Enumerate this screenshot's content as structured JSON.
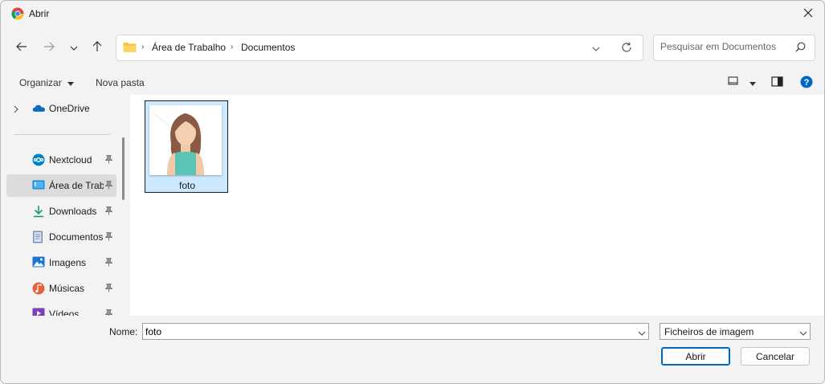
{
  "window": {
    "title": "Abrir",
    "app_icon": "chrome-icon",
    "close_icon": "close-icon"
  },
  "nav": {
    "back_icon": "arrow-left-icon",
    "forward_icon": "arrow-right-icon",
    "recent_icon": "chevron-down-icon",
    "up_icon": "arrow-up-icon",
    "breadcrumbs": [
      "Área de Trabalho",
      "Documentos"
    ],
    "search_placeholder": "Pesquisar em Documentos"
  },
  "commands": {
    "organize": "Organizar",
    "new_folder": "Nova pasta",
    "view_icon": "view-layout-icon",
    "preview_pane_icon": "preview-pane-icon",
    "help_icon": "help-icon"
  },
  "sidebar": {
    "items": [
      {
        "label": "OneDrive",
        "icon": "onedrive-icon",
        "pinned": false
      },
      {
        "label": "Nextcloud",
        "icon": "nextcloud-icon",
        "pinned": true
      },
      {
        "label": "Área de Trabalho",
        "icon": "desktop-icon",
        "pinned": true,
        "selected": true
      },
      {
        "label": "Downloads",
        "icon": "download-icon",
        "pinned": true
      },
      {
        "label": "Documentos",
        "icon": "documents-icon",
        "pinned": true
      },
      {
        "label": "Imagens",
        "icon": "pictures-icon",
        "pinned": true
      },
      {
        "label": "Músicas",
        "icon": "music-icon",
        "pinned": true
      },
      {
        "label": "Vídeos",
        "icon": "videos-icon",
        "pinned": true
      }
    ]
  },
  "files": [
    {
      "name": "foto",
      "thumbnail": "woman-avatar-image",
      "selected": true
    }
  ],
  "footer": {
    "name_label": "Nome:",
    "name_value": "foto",
    "file_type": "Ficheiros de imagem",
    "open_label": "Abrir",
    "cancel_label": "Cancelar"
  },
  "colors": {
    "accent": "#0067c0",
    "selection": "#cce8ff",
    "help": "#0067c0"
  }
}
